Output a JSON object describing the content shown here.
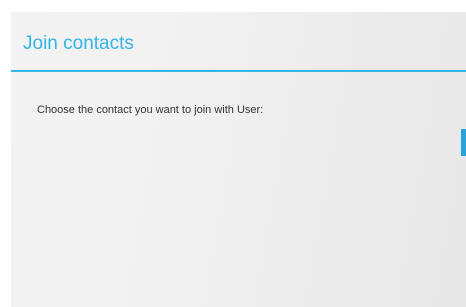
{
  "dialog": {
    "title": "Join contacts",
    "message": "Choose the contact you want to join with User:"
  },
  "colors": {
    "accent": "#33b5e5",
    "scroll_indicator": "#2aa3d8",
    "dialog_background": "#f1f1f1",
    "message_text": "#333333"
  }
}
